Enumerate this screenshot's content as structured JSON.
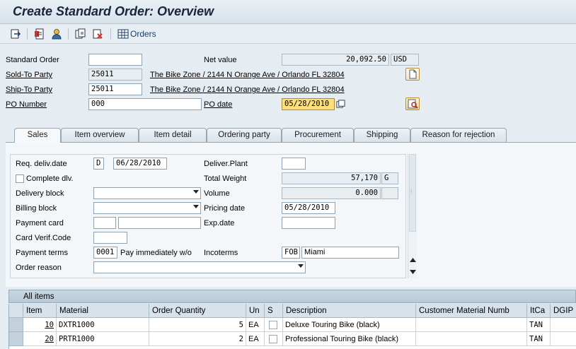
{
  "window": {
    "title": "Create Standard Order: Overview"
  },
  "toolbar": {
    "orders_label": "Orders",
    "icons": [
      "display-doc-header-icon",
      "header-details-icon",
      "business-partner-icon",
      "copy-icon",
      "delete-icon",
      "orders-grid-icon"
    ]
  },
  "header": {
    "standard_order_label": "Standard Order",
    "standard_order_value": "",
    "net_value_label": "Net value",
    "net_value": "20,092.50",
    "currency": "USD",
    "sold_to_label": "Sold-To Party",
    "sold_to_value": "25011",
    "sold_to_address": "The Bike Zone / 2144 N Orange Ave / Orlando FL 32804",
    "ship_to_label": "Ship-To Party",
    "ship_to_value": "25011",
    "ship_to_address": "The Bike Zone / 2144 N Orange Ave / Orlando FL 32804",
    "po_number_label": "PO Number",
    "po_number_value": "000",
    "po_date_label": "PO date",
    "po_date_value": "05/28/2010"
  },
  "tabs": [
    {
      "label": "Sales",
      "active": true
    },
    {
      "label": "Item overview"
    },
    {
      "label": "Item detail"
    },
    {
      "label": "Ordering party"
    },
    {
      "label": "Procurement"
    },
    {
      "label": "Shipping"
    },
    {
      "label": "Reason for rejection"
    }
  ],
  "sales": {
    "req_deliv_label": "Req. deliv.date",
    "req_deliv_type": "D",
    "req_deliv_date": "06/28/2010",
    "deliver_plant_label": "Deliver.Plant",
    "deliver_plant_value": "",
    "complete_dlv_label": "Complete dlv.",
    "total_weight_label": "Total Weight",
    "total_weight_value": "57,170",
    "total_weight_unit": "G",
    "delivery_block_label": "Delivery block",
    "volume_label": "Volume",
    "volume_value": "0.000",
    "billing_block_label": "Billing block",
    "pricing_date_label": "Pricing date",
    "pricing_date_value": "05/28/2010",
    "payment_card_label": "Payment card",
    "exp_date_label": "Exp.date",
    "card_verif_label": "Card Verif.Code",
    "payment_terms_label": "Payment terms",
    "payment_terms_code": "0001",
    "payment_terms_text": "Pay immediately w/o",
    "incoterms_label": "Incoterms",
    "incoterms_code": "FOB",
    "incoterms_place": "Miami",
    "order_reason_label": "Order reason"
  },
  "items": {
    "title": "All items",
    "columns": [
      "Item",
      "Material",
      "Order Quantity",
      "Un",
      "S",
      "Description",
      "Customer Material Numb",
      "ItCa",
      "DGIP"
    ],
    "rows": [
      {
        "item": "10",
        "material": "DXTR1000",
        "qty": "5",
        "un": "EA",
        "desc": "Deluxe Touring Bike (black)",
        "itca": "TAN"
      },
      {
        "item": "20",
        "material": "PRTR1000",
        "qty": "2",
        "un": "EA",
        "desc": "Professional Touring Bike (black)",
        "itca": "TAN"
      }
    ]
  },
  "colors": {
    "title_text": "#17243a",
    "highlight_field": "#fde07c",
    "tab_border": "#95a8b6"
  }
}
